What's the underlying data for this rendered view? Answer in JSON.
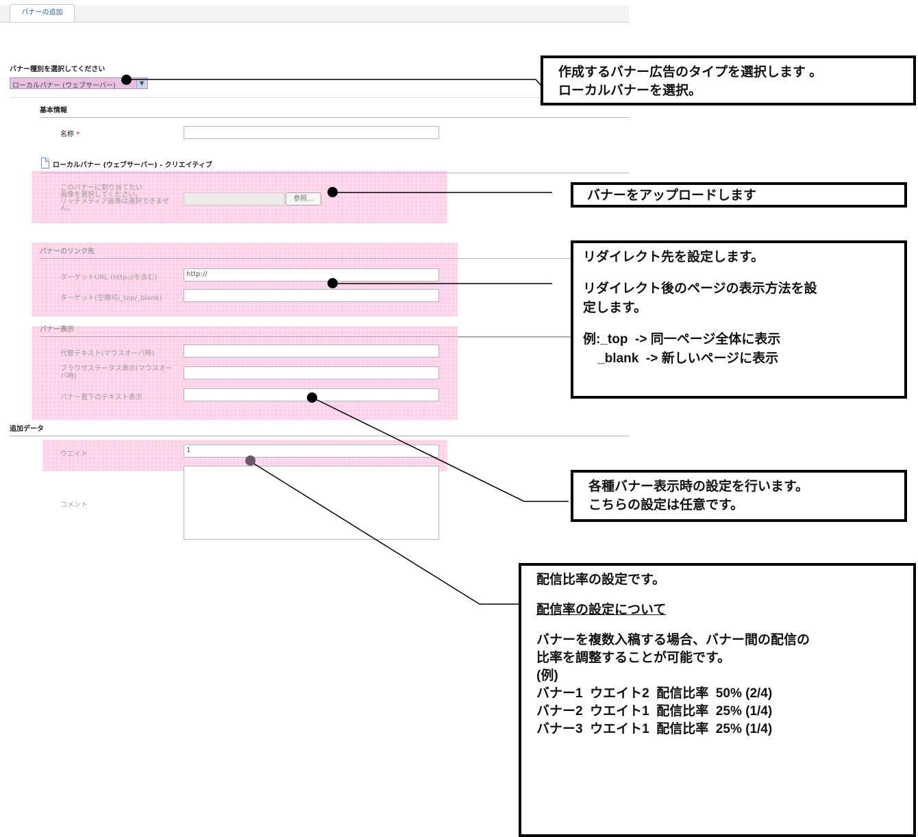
{
  "tab": {
    "label": "バナーの追加"
  },
  "banner_type": {
    "heading": "バナー種別を選択してください",
    "selected": "ローカルバナー (ウェブサーバー)"
  },
  "basic_info": {
    "heading": "基本情報",
    "name_label": "名称",
    "required_mark": "*",
    "name_value": ""
  },
  "creative": {
    "heading": "ローカルバナー (ウェブサーバー) - クリエイティブ",
    "upload_label_lines": [
      "このバナーに割り当てたい",
      "画像を選択してください。",
      "リッチメディア画像は選択できませ",
      "ん。"
    ],
    "browse_button": "参照..."
  },
  "link": {
    "heading": "バナーのリンク先",
    "target_url_label": "ターゲットURL (http://を含む)",
    "target_url_value": "http://",
    "target_label": "ターゲット(空欄可/_top/_blank)",
    "target_value": ""
  },
  "display": {
    "heading": "バナー表示",
    "alt_text_label": "代替テキスト(マウスオーバ時)",
    "status_label_lines": [
      "ブラウザステータス表示(マウスオー",
      "バ時)"
    ],
    "below_text_label": "バナー直下のテキスト表示"
  },
  "extra": {
    "heading": "追加データ",
    "weight_label": "ウエイト",
    "weight_value": "1",
    "comment_label": "コメント",
    "comment_value": ""
  },
  "callouts": {
    "type": [
      "作成するバナー広告のタイプを選択します 。",
      "ローカルバナーを選択。"
    ],
    "upload": [
      "バナーをアップロードします"
    ],
    "redirect": [
      "リダイレクト先を設定します。",
      "",
      "リダイレクト後のページの表示方法を設",
      "定します。",
      "",
      "例:_top  -> 同一ページ全体に表示",
      "    _blank  -> 新しいページに表示"
    ],
    "display": [
      "各種バナー表示時の設定を行います。",
      "こちらの設定は任意です。"
    ],
    "weight": [
      "配信比率の設定です。",
      "",
      "配信率の設定について",
      "",
      "バナーを複数入稿する場合、バナー間の配信の",
      "比率を調整することが可能です。",
      "(例)",
      "バナー1  ウエイト2  配信比率  50% (2/4)",
      "バナー2  ウエイト1  配信比率  25% (1/4)",
      "バナー3  ウエイト1  配信比率  25% (1/4)"
    ]
  },
  "colors": {
    "highlight": "#ff96cd",
    "tab_text": "#2a5a9a",
    "required": "#cc0000"
  }
}
